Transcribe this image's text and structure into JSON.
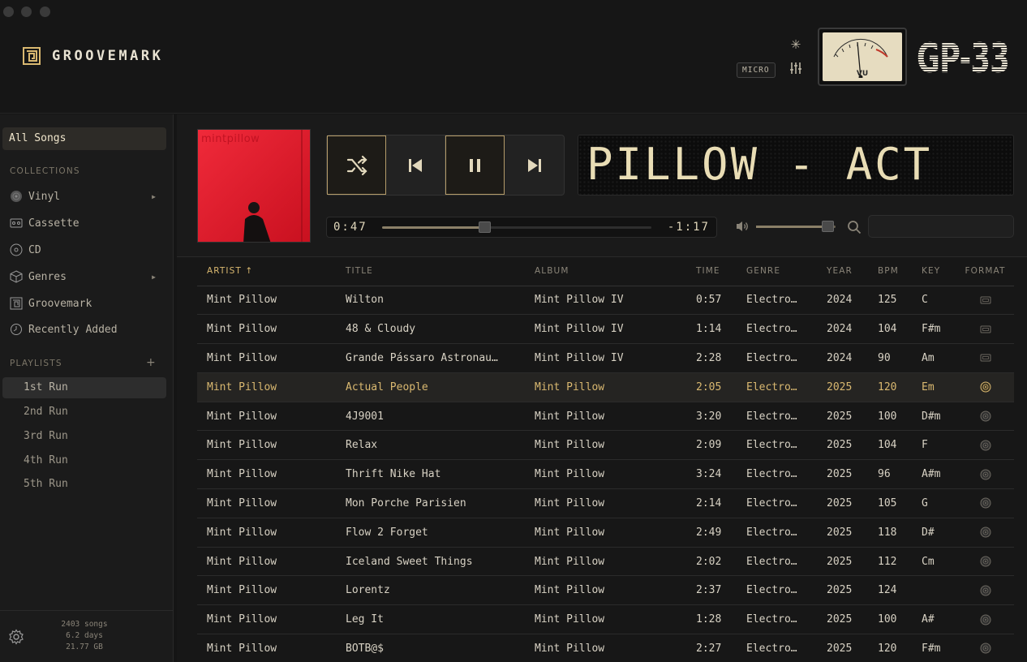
{
  "app": {
    "brand_name": "GROOVEMARK",
    "micro_label": "MICRO",
    "vu_label": "VU",
    "model_label": "GP-33"
  },
  "sidebar": {
    "all_songs": "All Songs",
    "collections_header": "COLLECTIONS",
    "collections": [
      {
        "label": "Vinyl",
        "icon": "vinyl-icon",
        "has_arrow": true
      },
      {
        "label": "Cassette",
        "icon": "cassette-icon",
        "has_arrow": false
      },
      {
        "label": "CD",
        "icon": "cd-icon",
        "has_arrow": false
      },
      {
        "label": "Genres",
        "icon": "cube-icon",
        "has_arrow": true
      },
      {
        "label": "Groovemark",
        "icon": "groovemark-icon",
        "has_arrow": false
      },
      {
        "label": "Recently Added",
        "icon": "clock-icon",
        "has_arrow": false
      }
    ],
    "playlists_header": "PLAYLISTS",
    "add_playlist": "+",
    "playlists": [
      "1st Run",
      "2nd Run",
      "3rd Run",
      "4th Run",
      "5th Run"
    ],
    "active_playlist": "1st Run",
    "stats": {
      "songs": "2403 songs",
      "duration": "6.2 days",
      "size": "21.77 GB"
    }
  },
  "player": {
    "album_art_title": "mintpillow",
    "lcd_text": "PILLOW - ACT",
    "elapsed": "0:47",
    "remaining": "-1:17",
    "progress": 0.38,
    "volume": 0.9,
    "shuffle_on": true,
    "playing": true,
    "search_placeholder": "",
    "accent_color": "#d9b870"
  },
  "table": {
    "columns": [
      "ARTIST ↑",
      "TITLE",
      "ALBUM",
      "TIME",
      "GENRE",
      "YEAR",
      "BPM",
      "KEY",
      "FORMAT"
    ],
    "sorted_column": 0,
    "active_row": 3,
    "rows": [
      [
        "Mint Pillow",
        "Wilton",
        "Mint Pillow IV",
        "0:57",
        "Electro…",
        "2024",
        "125",
        "C",
        "cassette"
      ],
      [
        "Mint Pillow",
        "48 & Cloudy",
        "Mint Pillow IV",
        "1:14",
        "Electro…",
        "2024",
        "104",
        "F#m",
        "cassette"
      ],
      [
        "Mint Pillow",
        "Grande Pássaro Astronau…",
        "Mint Pillow IV",
        "2:28",
        "Electro…",
        "2024",
        "90",
        "Am",
        "cassette"
      ],
      [
        "Mint Pillow",
        "Actual People",
        "Mint Pillow",
        "2:05",
        "Electro…",
        "2025",
        "120",
        "Em",
        "cd"
      ],
      [
        "Mint Pillow",
        "4J9001",
        "Mint Pillow",
        "3:20",
        "Electro…",
        "2025",
        "100",
        "D#m",
        "cd"
      ],
      [
        "Mint Pillow",
        "Relax",
        "Mint Pillow",
        "2:09",
        "Electro…",
        "2025",
        "104",
        "F",
        "cd"
      ],
      [
        "Mint Pillow",
        "Thrift Nike Hat",
        "Mint Pillow",
        "3:24",
        "Electro…",
        "2025",
        "96",
        "A#m",
        "cd"
      ],
      [
        "Mint Pillow",
        "Mon Porche Parisien",
        "Mint Pillow",
        "2:14",
        "Electro…",
        "2025",
        "105",
        "G",
        "cd"
      ],
      [
        "Mint Pillow",
        "Flow 2 Forget",
        "Mint Pillow",
        "2:49",
        "Electro…",
        "2025",
        "118",
        "D#",
        "cd"
      ],
      [
        "Mint Pillow",
        "Iceland Sweet Things",
        "Mint Pillow",
        "2:02",
        "Electro…",
        "2025",
        "112",
        "Cm",
        "cd"
      ],
      [
        "Mint Pillow",
        "Lorentz",
        "Mint Pillow",
        "2:37",
        "Electro…",
        "2025",
        "124",
        "",
        "cd"
      ],
      [
        "Mint Pillow",
        "Leg It",
        "Mint Pillow",
        "1:28",
        "Electro…",
        "2025",
        "100",
        "A#",
        "cd"
      ],
      [
        "Mint Pillow",
        "BOTB@$",
        "Mint Pillow",
        "2:27",
        "Electro…",
        "2025",
        "120",
        "F#m",
        "cd"
      ]
    ]
  }
}
